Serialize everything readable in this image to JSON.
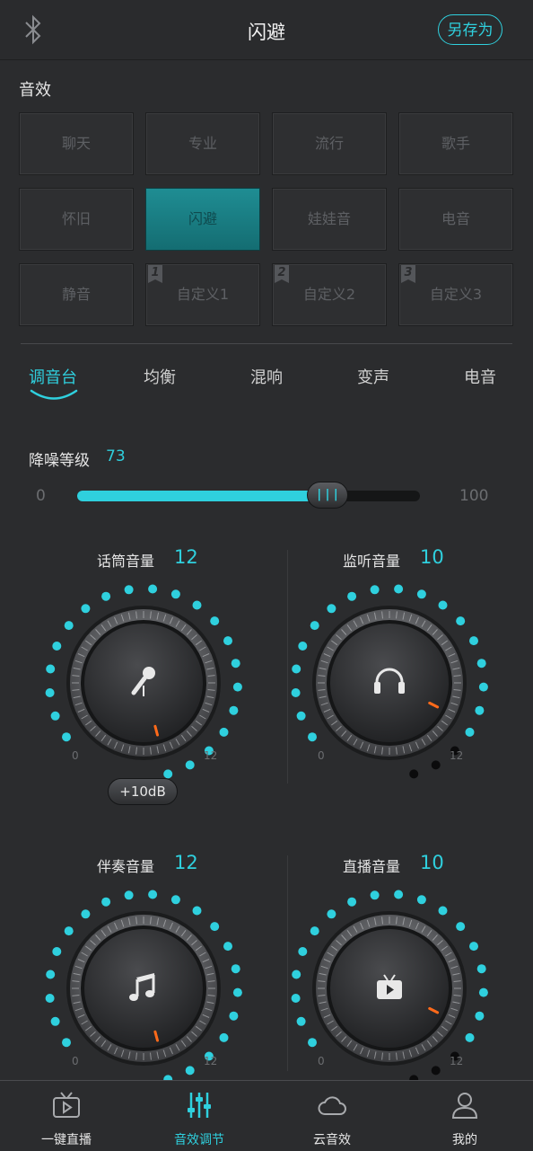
{
  "header": {
    "title": "闪避",
    "save_as": "另存为",
    "bluetooth_icon": "bluetooth-icon"
  },
  "presets": {
    "title": "音效",
    "items": [
      {
        "label": "聊天"
      },
      {
        "label": "专业"
      },
      {
        "label": "流行"
      },
      {
        "label": "歌手"
      },
      {
        "label": "怀旧"
      },
      {
        "label": "闪避",
        "active": true
      },
      {
        "label": "娃娃音"
      },
      {
        "label": "电音"
      },
      {
        "label": "静音"
      },
      {
        "label": "自定义1",
        "badge": "1"
      },
      {
        "label": "自定义2",
        "badge": "2"
      },
      {
        "label": "自定义3",
        "badge": "3"
      }
    ]
  },
  "tabs": [
    {
      "label": "调音台",
      "active": true
    },
    {
      "label": "均衡"
    },
    {
      "label": "混响"
    },
    {
      "label": "变声"
    },
    {
      "label": "电音"
    }
  ],
  "noise": {
    "label": "降噪等级",
    "value": "73",
    "level": 73,
    "min": "0",
    "max": "100"
  },
  "knobs": [
    {
      "label": "话筒音量",
      "value": "12",
      "level": 12,
      "min": "0",
      "max": "12",
      "icon": "microphone-icon"
    },
    {
      "label": "监听音量",
      "value": "10",
      "level": 10,
      "min": "0",
      "max": "12",
      "icon": "headphones-icon"
    },
    {
      "label": "伴奏音量",
      "value": "12",
      "level": 12,
      "min": "0",
      "max": "12",
      "icon": "music-note-icon"
    },
    {
      "label": "直播音量",
      "value": "10",
      "level": 10,
      "min": "0",
      "max": "12",
      "icon": "tv-play-icon"
    }
  ],
  "boost_button": "+10dB",
  "nav": [
    {
      "label": "一键直播",
      "icon": "live-tv-icon"
    },
    {
      "label": "音效调节",
      "icon": "equalizer-icon",
      "active": true
    },
    {
      "label": "云音效",
      "icon": "cloud-icon"
    },
    {
      "label": "我的",
      "icon": "user-icon"
    }
  ],
  "colors": {
    "accent": "#2fd0de",
    "active_preset": "#1a7f85",
    "indicator": "#ff6a1a"
  }
}
